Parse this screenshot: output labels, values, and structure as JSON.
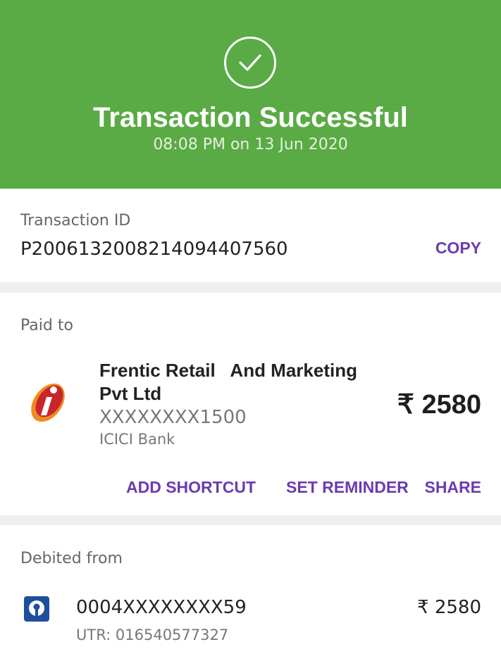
{
  "header": {
    "icon": "check-circle-icon",
    "title": "Transaction Successful",
    "timestamp": "08:08 PM on 13 Jun 2020",
    "color": "#5aaa46"
  },
  "transaction": {
    "label": "Transaction ID",
    "id": "P2006132008214094407560",
    "copy_label": "COPY"
  },
  "paid_to": {
    "label": "Paid to",
    "bank_icon": "icici-bank-logo-icon",
    "name": "Frentic Retail   And Marketing Pvt Ltd",
    "account": "XXXXXXXX1500",
    "bank": "ICICI Bank",
    "amount": "₹ 2580",
    "actions": {
      "add_shortcut": "ADD SHORTCUT",
      "set_reminder": "SET REMINDER",
      "share": "SHARE"
    }
  },
  "debited_from": {
    "label": "Debited from",
    "bank_icon": "sbi-bank-logo-icon",
    "account": "0004XXXXXXXX59",
    "utr": "UTR: 016540577327",
    "amount": "₹ 2580"
  },
  "colors": {
    "accent": "#6a3cae",
    "success": "#5aaa46"
  }
}
